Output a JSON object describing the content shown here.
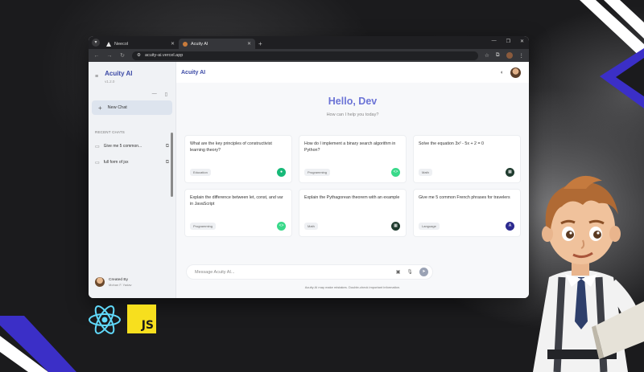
{
  "browser": {
    "tabs": [
      {
        "label": "Neecol",
        "active": false
      },
      {
        "label": "Acuity AI",
        "active": true
      }
    ],
    "url": "acuity-ai.vercel.app",
    "profile_initial": "M"
  },
  "sidebar": {
    "brand": "Acuity AI",
    "version": "v1.2.0",
    "new_chat_label": "New Chat",
    "recent_label": "RECENT CHATS",
    "recent_items": [
      {
        "label": "Give me 5 common..."
      },
      {
        "label": "full form of jsx"
      }
    ],
    "created_by_label": "Created By",
    "creator_name": "Mohan F. Yadav"
  },
  "header": {
    "title": "Acuity AI"
  },
  "welcome": {
    "greeting": "Hello, Dev",
    "subtitle": "How can I help you today?"
  },
  "cards": [
    {
      "text": "What are the key principles of constructivist learning theory?",
      "tag": "Education",
      "icon_color": "#17b978"
    },
    {
      "text": "How do I implement a binary search algorithm in Python?",
      "tag": "Programming",
      "icon_color": "#39d98a"
    },
    {
      "text": "Solve the equation 3x² - 5x + 2 = 0",
      "tag": "Math",
      "icon_color": "#1f3b2e"
    },
    {
      "text": "Explain the difference between let, const, and var in JavaScript",
      "tag": "Programming",
      "icon_color": "#39d98a"
    },
    {
      "text": "Explain the Pythagorean theorem with an example",
      "tag": "Math",
      "icon_color": "#1f3b2e"
    },
    {
      "text": "Give me 5 common French phrases for travelers",
      "tag": "Language",
      "icon_color": "#2c2a8f"
    }
  ],
  "composer": {
    "placeholder": "Message Acuity AI..."
  },
  "disclaimer": "Acuity AI may make mistakes. Double-check important information.",
  "logos": {
    "js": "JS"
  },
  "colors": {
    "accent": "#6b73d6",
    "brand": "#3c4aa6",
    "js_yellow": "#f7df1e",
    "react_blue": "#61dafb"
  }
}
